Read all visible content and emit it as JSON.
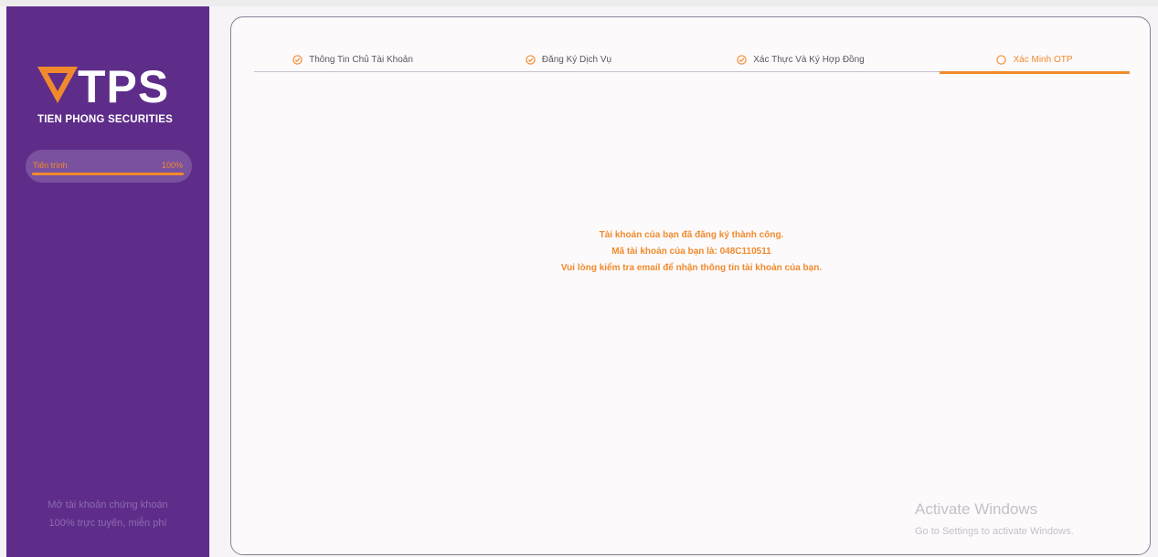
{
  "brand": {
    "logo_text": "TPS",
    "subtitle": "TIEN PHONG SECURITIES",
    "colors": {
      "purple": "#5e2d8a",
      "orange": "#f08a2c"
    }
  },
  "sidebar": {
    "progress": {
      "label": "Tiến trình",
      "value_text": "100%",
      "value": 1.0
    },
    "footer_line1": "Mở tài khoản chứng khoán",
    "footer_line2": "100% trực tuyến, miễn phí"
  },
  "steps": [
    {
      "label": "Thông Tin Chủ Tài Khoản",
      "icon": "check-circle-icon",
      "state": "done"
    },
    {
      "label": "Đăng Ký Dịch Vụ",
      "icon": "check-circle-icon",
      "state": "done"
    },
    {
      "label": "Xác Thực Và Ký Hợp Đồng",
      "icon": "check-circle-icon",
      "state": "done"
    },
    {
      "label": "Xác Minh OTP",
      "icon": "circle-icon",
      "state": "active"
    }
  ],
  "message": {
    "line1": "Tài khoản của bạn đã đăng ký thành công.",
    "line2": "Mã tài khoản của bạn là: 048C110511",
    "line3": "Vui lòng kiểm tra email để nhận thông tin tài khoản của bạn."
  },
  "watermark": {
    "title": "Activate Windows",
    "subtitle": "Go to Settings to activate Windows."
  }
}
